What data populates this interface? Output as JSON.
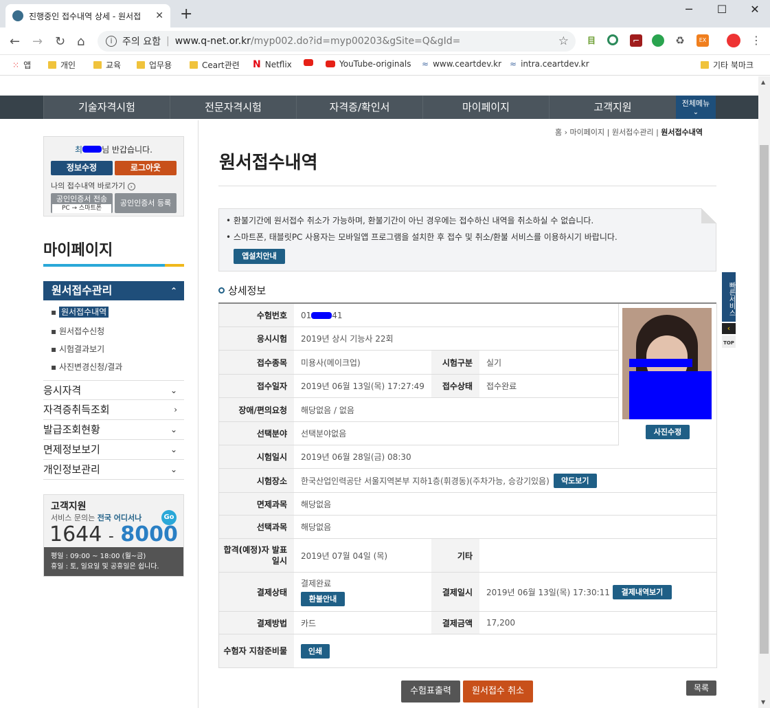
{
  "browser": {
    "tab_title": "진행중인 접수내역 상세 - 원서접",
    "tab_close": "✕",
    "new_tab": "+",
    "security_label": "주의 요함",
    "url_domain": "www.q-net.or.kr",
    "url_path": "/myp002.do?id=myp00203&gSite=Q&gId=",
    "window": {
      "min": "─",
      "max": "☐",
      "close": "✕"
    },
    "bookmarks": [
      "앱",
      "개인",
      "교육",
      "업무용",
      "Ceart관련",
      "Netflix",
      "YouTube-originals",
      "www.ceartdev.kr",
      "intra.ceartdev.kr"
    ],
    "other_bookmarks": "기타 북마크"
  },
  "site": {
    "gnb": [
      "기술자격시험",
      "전문자격시험",
      "자격증/확인서",
      "마이페이지",
      "고객지원"
    ],
    "all_menu": "전체메뉴"
  },
  "sidebar": {
    "greeting_prefix": "최",
    "greeting_suffix": "님 반갑습니다.",
    "edit_btn": "정보수정",
    "logout_btn": "로그아웃",
    "shortcut": "나의 접수내역 바로가기",
    "cert_transfer": "공인인증서 전송",
    "cert_sub": "PC → 스마트폰",
    "cert_register": "공인인증서 등록",
    "title": "마이페이지",
    "active_section": "원서접수관리",
    "subitems": [
      "원서접수내역",
      "원서접수신청",
      "시험결과보기",
      "사진변경신청/결과"
    ],
    "sections": [
      "응시자격",
      "자격증취득조회",
      "발급조회현황",
      "면제정보보기",
      "개인정보관리"
    ],
    "cs_title": "고객지원",
    "cs_desc_prefix": "서비스 문의는 ",
    "cs_desc_hl": "전국 어디서나",
    "cs_go": "Go",
    "phone_a": "1644",
    "phone_dash": "-",
    "phone_b": "8000",
    "hours": "평일 : 09:00 ~ 18:00 (월~금)",
    "holiday": "휴일 : 토, 일요일 및 공휴일은 쉽니다."
  },
  "breadcrumb": [
    "홈",
    "마이페이지",
    "원서접수관리",
    "원서접수내역"
  ],
  "page_title": "원서접수내역",
  "notice": [
    "환불기간에 원서접수 취소가 가능하며, 환불기간이 아닌 경우에는 접수하신 내역을 취소하실 수 없습니다.",
    "스마트폰, 태블릿PC 사용자는 모바일앱 프로그램을 설치한 후 접수 및 취소/환불 서비스를 이용하시기 바랍니다."
  ],
  "app_btn": "앱설치안내",
  "detail_title": "상세정보",
  "side_service": "빠른서비스",
  "side_top": "TOP",
  "detail": {
    "exam_no_label": "수험번호",
    "exam_no": "01",
    "exam_label": "응시시험",
    "exam": "2019년 상시 기능사 22회",
    "type_label": "접수종목",
    "type": "미용사(메이크업)",
    "kind_label": "시험구분",
    "kind": "실기",
    "date_label": "접수일자",
    "date": "2019년 06월 13일(목) 17:27:49",
    "status_label": "접수상태",
    "status": "접수완료",
    "disable_label": "장애/편의요청",
    "disable": "해당없음 / 없음",
    "field_label": "선택분야",
    "field": "선택분야없음",
    "exam_date_label": "시험일시",
    "exam_date": "2019년 06월 28일(금) 08:30",
    "place_label": "시험장소",
    "place": "한국산업인력공단 서울지역본부 지하1층(휘경동)(주차가능, 승강기있음)",
    "map_btn": "약도보기",
    "exempt_label": "면제과목",
    "exempt": "해당없음",
    "select_label": "선택과목",
    "select": "해당없음",
    "pass_label": "합격(예정)자 발표일시",
    "pass": "2019년 07월 04일 (목)",
    "etc_label": "기타",
    "etc": "",
    "pay_status_label": "결제상태",
    "pay_status": "결제완료",
    "refund_btn": "환불안내",
    "pay_date_label": "결제일시",
    "pay_date": "2019년 06월 13일(목) 17:30:11",
    "pay_detail_btn": "결제내역보기",
    "pay_method_label": "결제방법",
    "pay_method": "카드",
    "amount_label": "결제금액",
    "amount": "17,200",
    "guide_label": "수험자 지참준비물",
    "print_btn": "인쇄",
    "photo_btn": "사진수정"
  },
  "buttons": {
    "print_ticket": "수험표출력",
    "cancel": "원서접수 취소",
    "list": "목록"
  }
}
